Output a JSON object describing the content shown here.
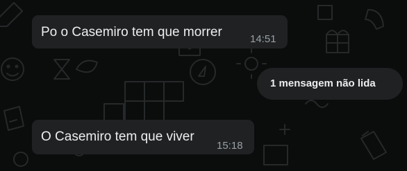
{
  "colors": {
    "background": "#0b0c0c",
    "bubble": "#1f2123",
    "text": "#eceeef",
    "timestamp": "#9aa0a4",
    "wallpaper_doodle": "#26292a"
  },
  "messages": [
    {
      "text": "Po o Casemiro tem que morrer",
      "time": "14:51"
    },
    {
      "text": "O Casemiro tem que viver",
      "time": "15:18"
    }
  ],
  "unread_divider": {
    "label": "1 mensagem não lida"
  },
  "wallpaper": {
    "pattern": "chat-doodle-pattern"
  }
}
